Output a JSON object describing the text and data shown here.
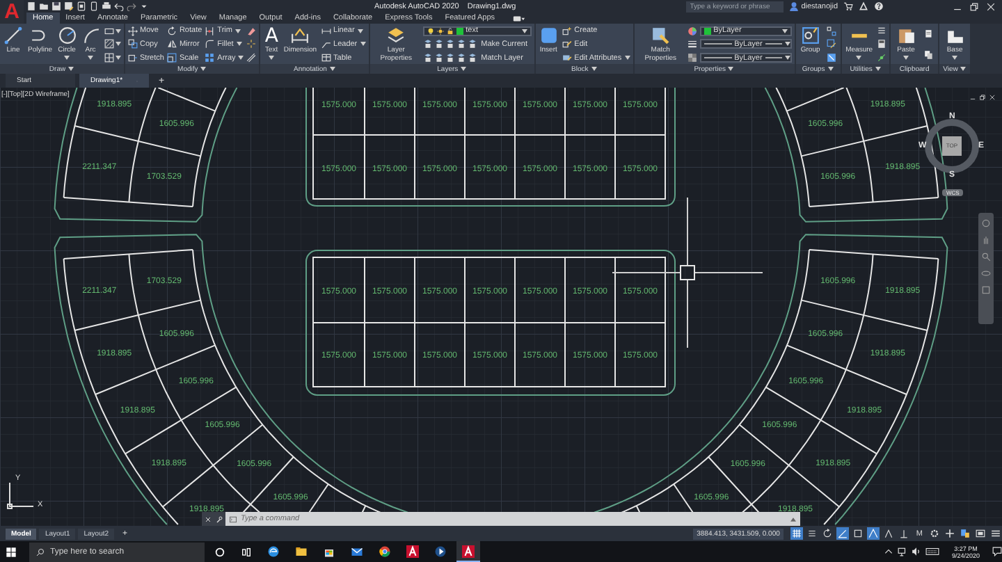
{
  "app_logo": "A",
  "title_bar": {
    "title": "Autodesk AutoCAD 2020",
    "document": "Drawing1.dwg",
    "search_placeholder": "Type a keyword or phrase",
    "user": "diestanojid"
  },
  "ribbon_tabs": [
    {
      "label": "Home",
      "selected": true
    },
    {
      "label": "Insert",
      "selected": false
    },
    {
      "label": "Annotate",
      "selected": false
    },
    {
      "label": "Parametric",
      "selected": false
    },
    {
      "label": "View",
      "selected": false
    },
    {
      "label": "Manage",
      "selected": false
    },
    {
      "label": "Output",
      "selected": false
    },
    {
      "label": "Add-ins",
      "selected": false
    },
    {
      "label": "Collaborate",
      "selected": false
    },
    {
      "label": "Express Tools",
      "selected": false
    },
    {
      "label": "Featured Apps",
      "selected": false
    }
  ],
  "ribbon_panels": [
    {
      "title": "Draw",
      "dropdown": true,
      "columns": [
        [
          {
            "kind": "large",
            "label": "Line",
            "menu": false
          }
        ],
        [
          {
            "kind": "large",
            "label": "Polyline",
            "menu": false
          }
        ],
        [
          {
            "kind": "large",
            "label": "Circle",
            "menu": true
          }
        ],
        [
          {
            "kind": "large",
            "label": "Arc",
            "menu": true
          }
        ],
        [
          {
            "kind": "icon",
            "menu": true
          },
          {
            "kind": "icon",
            "menu": true
          },
          {
            "kind": "icon",
            "menu": true
          }
        ]
      ]
    },
    {
      "title": "Modify",
      "dropdown": true,
      "columns": [
        [
          {
            "kind": "small",
            "label": "Move",
            "menu": false
          },
          {
            "kind": "small",
            "label": "Copy",
            "menu": false
          },
          {
            "kind": "small",
            "label": "Stretch",
            "menu": false
          }
        ],
        [
          {
            "kind": "small",
            "label": "Rotate",
            "menu": false
          },
          {
            "kind": "small",
            "label": "Mirror",
            "menu": false
          },
          {
            "kind": "small",
            "label": "Scale",
            "menu": false
          }
        ],
        [
          {
            "kind": "small",
            "label": "Trim",
            "menu": true
          },
          {
            "kind": "small",
            "label": "Fillet",
            "menu": true
          },
          {
            "kind": "small",
            "label": "Array",
            "menu": true
          }
        ],
        [
          {
            "kind": "icon",
            "menu": false
          },
          {
            "kind": "icon",
            "menu": false
          },
          {
            "kind": "icon",
            "menu": false
          }
        ]
      ]
    },
    {
      "title": "Annotation",
      "dropdown": true,
      "columns": [
        [
          {
            "kind": "large",
            "label": "Text",
            "glyph": "A",
            "menu": true
          }
        ],
        [
          {
            "kind": "large",
            "label": "Dimension",
            "menu": false
          }
        ],
        [
          {
            "kind": "small",
            "label": "Linear",
            "menu": true
          },
          {
            "kind": "small",
            "label": "Leader",
            "menu": true
          },
          {
            "kind": "small",
            "label": "Table",
            "menu": false
          }
        ]
      ]
    },
    {
      "title": "Layers",
      "dropdown": true,
      "columns": [
        [
          {
            "kind": "large",
            "label": "Layer Properties",
            "menu": false
          }
        ],
        [
          {
            "kind": "layer-dropdown",
            "value": "text",
            "color": "#1fc23a"
          },
          {
            "kind": "tool-row",
            "label": "Make Current"
          },
          {
            "kind": "tool-row",
            "label": "Match Layer"
          }
        ]
      ]
    },
    {
      "title": "Block",
      "dropdown": true,
      "columns": [
        [
          {
            "kind": "large",
            "label": "Insert",
            "menu": false
          }
        ],
        [
          {
            "kind": "small",
            "label": "Create",
            "menu": false
          },
          {
            "kind": "small",
            "label": "Edit",
            "menu": false
          },
          {
            "kind": "small",
            "label": "Edit Attributes",
            "menu": true
          }
        ]
      ]
    },
    {
      "title": "Properties",
      "dropdown": true,
      "columns": [
        [
          {
            "kind": "large",
            "label": "Match Properties",
            "menu": false
          }
        ],
        [
          {
            "kind": "icon",
            "menu": false
          },
          {
            "kind": "icon",
            "menu": false
          },
          {
            "kind": "icon",
            "menu": false
          }
        ],
        [
          {
            "kind": "color-dropdown",
            "value": "ByLayer",
            "color": "#1fc23a"
          },
          {
            "kind": "line-dropdown",
            "value": "ByLayer"
          },
          {
            "kind": "line-dropdown",
            "value": "ByLayer"
          }
        ]
      ]
    },
    {
      "title": "Groups",
      "dropdown": true,
      "columns": [
        [
          {
            "kind": "large",
            "label": "Group",
            "menu": false
          }
        ],
        [
          {
            "kind": "icon",
            "menu": false
          },
          {
            "kind": "icon",
            "menu": false
          },
          {
            "kind": "icon",
            "menu": false
          }
        ]
      ]
    },
    {
      "title": "Utilities",
      "dropdown": true,
      "columns": [
        [
          {
            "kind": "large",
            "label": "Measure",
            "menu": true
          }
        ],
        [
          {
            "kind": "icon",
            "menu": false
          },
          {
            "kind": "icon",
            "menu": false
          },
          {
            "kind": "icon",
            "menu": false
          }
        ]
      ]
    },
    {
      "title": "Clipboard",
      "dropdown": false,
      "columns": [
        [
          {
            "kind": "large",
            "label": "Paste",
            "menu": true
          }
        ],
        [
          {
            "kind": "icon",
            "menu": false
          },
          {
            "kind": "icon",
            "menu": false
          }
        ]
      ]
    },
    {
      "title": "View",
      "dropdown": true,
      "columns": [
        [
          {
            "kind": "large",
            "label": "Base",
            "menu": true
          }
        ]
      ]
    }
  ],
  "file_tabs": [
    {
      "label": "Start",
      "selected": false
    },
    {
      "label": "Drawing1*",
      "selected": true
    }
  ],
  "new_file_tab": "+",
  "viewport": {
    "view_label": "[-][Top][2D Wireframe]",
    "compass": {
      "north": "N",
      "south": "S",
      "east": "E",
      "west": "W",
      "top": "TOP"
    },
    "coordinate_system": "WCS",
    "ucs": {
      "x": "X",
      "y": "Y"
    }
  },
  "drawing": {
    "top_table": [
      [
        "1575.000",
        "1575.000",
        "1575.000",
        "1575.000",
        "1575.000",
        "1575.000",
        "1575.000"
      ],
      [
        "1575.000",
        "1575.000",
        "1575.000",
        "1575.000",
        "1575.000",
        "1575.000",
        "1575.000"
      ]
    ],
    "middle_table": [
      [
        "1575.000",
        "1575.000",
        "1575.000",
        "1575.000",
        "1575.000",
        "1575.000",
        "1575.000"
      ],
      [
        "1575.000",
        "1575.000",
        "1575.000",
        "1575.000",
        "1575.000",
        "1575.000",
        "1575.000"
      ]
    ],
    "curved_blocks": [
      {
        "tiles": [
          {
            "outer": "1918.895",
            "inner": "1605.996"
          },
          {
            "outer": "2211.347",
            "inner": "1703.529"
          }
        ]
      },
      {
        "tiles": [
          {
            "outer": "1918.895",
            "inner": "1605.996"
          },
          {
            "outer": "1918.895",
            "inner": "1605.996"
          }
        ]
      },
      {
        "tiles": [
          {
            "outer": "2211.347",
            "inner": "1703.529"
          },
          {
            "outer": "1918.895",
            "inner": "1605.996"
          },
          {
            "outer": "1918.895",
            "inner": "1605.996"
          },
          {
            "outer": "1918.895",
            "inner": "1605.996"
          },
          {
            "outer": "1918.895",
            "inner": "1605.996"
          },
          {
            "inner": "1605.996"
          }
        ]
      },
      {
        "tiles": [
          {
            "outer": "1918.895",
            "inner": "1605.996"
          },
          {
            "outer": "1918.895",
            "inner": "1605.996"
          },
          {
            "outer": "1918.895",
            "inner": "1605.996"
          },
          {
            "outer": "1918.895",
            "inner": "1605.996"
          },
          {
            "outer": "1918.895",
            "inner": "1605.996"
          },
          {
            "inner": "1605.996"
          }
        ]
      }
    ]
  },
  "command_line": {
    "placeholder": "Type a command"
  },
  "layout_tabs": [
    {
      "label": "Model",
      "selected": true
    },
    {
      "label": "Layout1",
      "selected": false
    },
    {
      "label": "Layout2",
      "selected": false
    }
  ],
  "new_layout_tab": "+",
  "status_bar": {
    "coordinates": "3884.413, 3431.509, 0.000",
    "toggles": [
      {
        "on": true
      },
      {
        "on": false
      },
      {
        "on": false
      },
      {
        "on": true
      },
      {
        "on": false
      },
      {
        "on": true
      },
      {
        "on": false
      },
      {
        "on": false
      }
    ],
    "scale_label": "M"
  },
  "taskbar": {
    "search_placeholder": "Type here to search",
    "apps": [
      {
        "selected": false
      },
      {
        "selected": false
      },
      {
        "selected": false
      },
      {
        "selected": false
      },
      {
        "selected": false
      },
      {
        "selected": false
      },
      {
        "selected": false
      },
      {
        "selected": true
      }
    ],
    "time": "3:27 PM",
    "date": "9/24/2020"
  }
}
